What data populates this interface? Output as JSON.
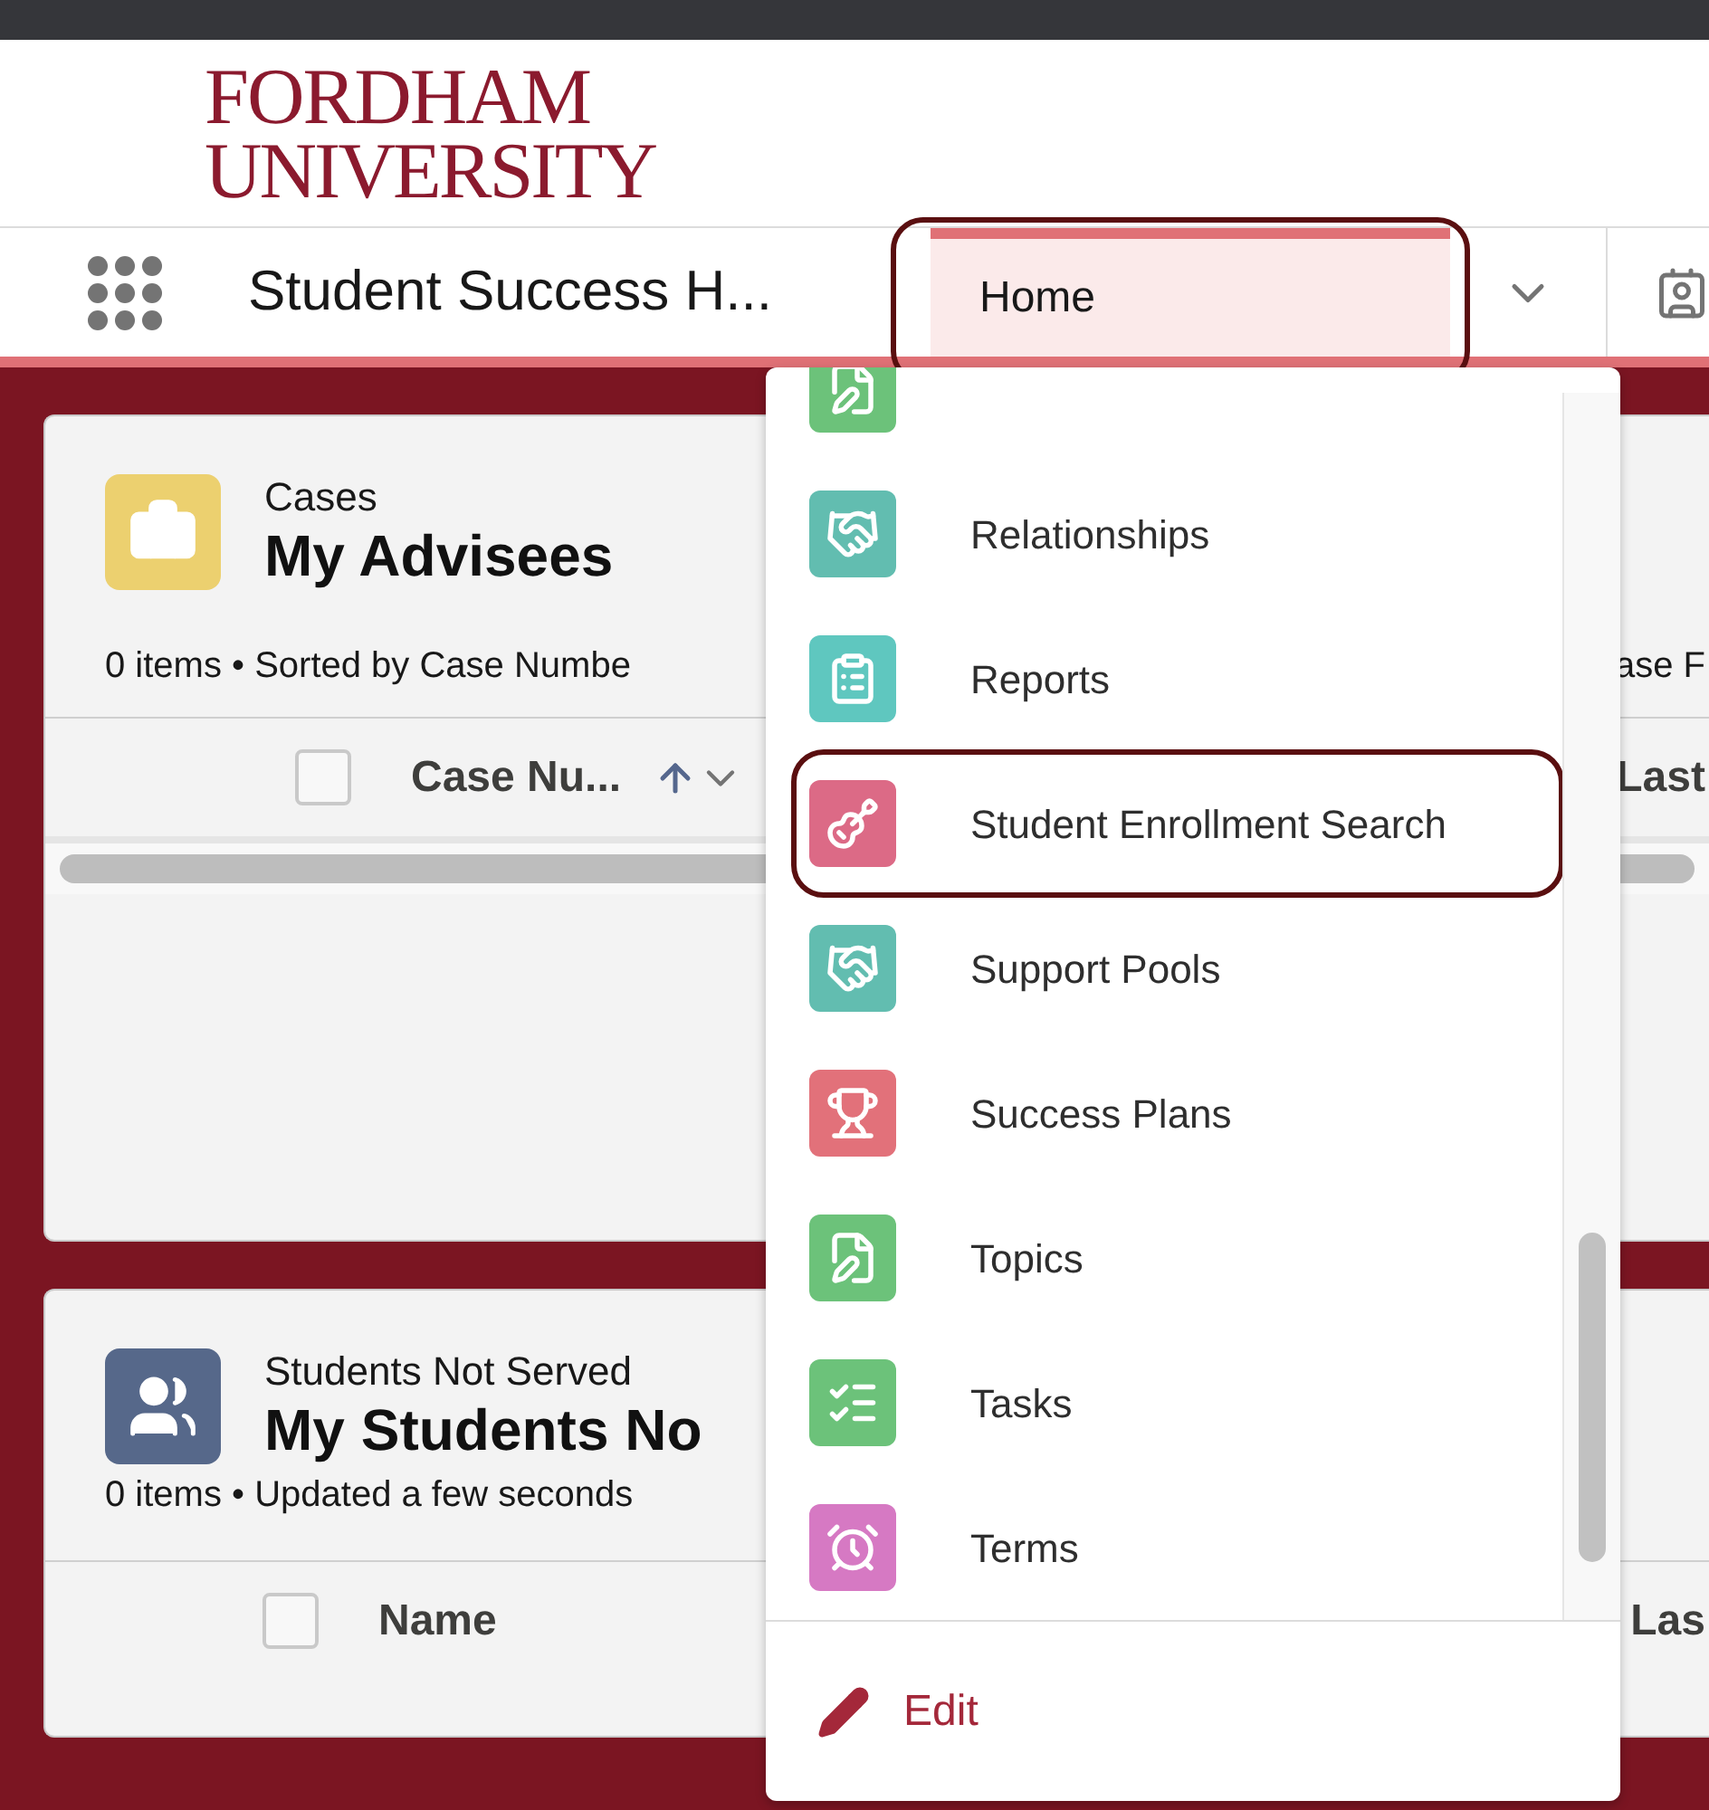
{
  "logo": {
    "line_1": "FORDHAM",
    "line_2": "UNIVERSITY"
  },
  "nav": {
    "app_name": "Student Success H...",
    "tabs": [
      {
        "label": "Home",
        "selected": true,
        "annotated": true
      }
    ]
  },
  "cards": [
    {
      "kind": "briefcase",
      "color": "#ecd06f",
      "object": "Cases",
      "title": "My Advisees",
      "meta": "0 items • Sorted by Case Numbe",
      "meta_right": "ase F",
      "checked": false,
      "columns": [
        {
          "label": "Case Nu...",
          "sorted": true
        }
      ],
      "column_right": "Last",
      "scrollbar": true
    },
    {
      "kind": "people",
      "color": "#56688a",
      "object": "Students Not Served",
      "title": "My Students No",
      "meta": "0 items • Updated a few seconds",
      "checked": false,
      "columns": [
        {
          "label": "Name",
          "sorted": false
        }
      ],
      "column_right": "Las",
      "scrollbar": false
    }
  ],
  "menu": {
    "items": [
      {
        "kind": "form",
        "color": "#6cc27a",
        "annotated": false
      },
      {
        "kind": "handshake",
        "label": "Relationships",
        "color": "#62bdb0",
        "annotated": false
      },
      {
        "kind": "report",
        "label": "Reports",
        "color": "#5fc7bf",
        "annotated": false
      },
      {
        "kind": "guitar",
        "label": "Student Enrollment Search",
        "color": "#dc6a86",
        "annotated": true
      },
      {
        "kind": "handshake",
        "label": "Support Pools",
        "color": "#62bdb0",
        "annotated": false
      },
      {
        "kind": "trophy",
        "label": "Success Plans",
        "color": "#e2717a",
        "annotated": false
      },
      {
        "kind": "form",
        "label": "Topics",
        "color": "#6cc27a",
        "annotated": false
      },
      {
        "kind": "tasks",
        "label": "Tasks",
        "color": "#6cc27a",
        "annotated": false
      },
      {
        "kind": "alarm",
        "label": "Terms",
        "color": "#d679c3",
        "annotated": false
      }
    ],
    "edit": "Edit"
  }
}
